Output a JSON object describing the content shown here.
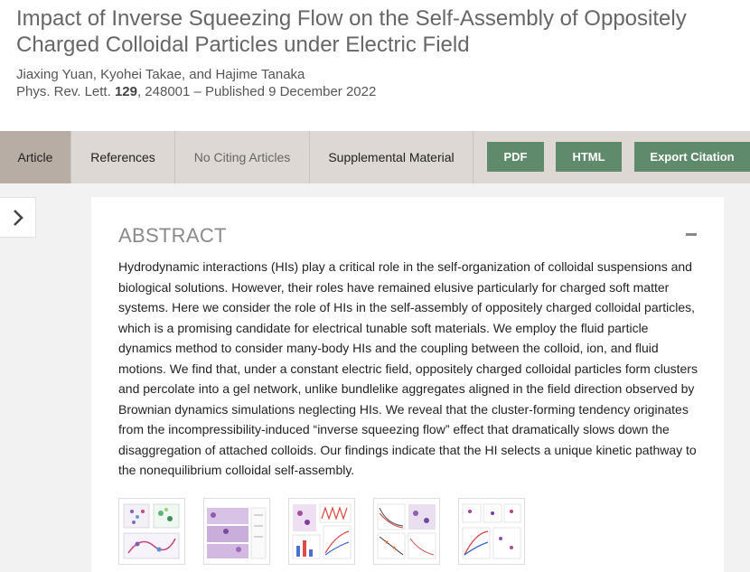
{
  "article": {
    "title": "Impact of Inverse Squeezing Flow on the Self-Assembly of Oppositely Charged Colloidal Particles under Electric Field",
    "authors": "Jiaxing Yuan, Kyohei Takae, and Hajime Tanaka",
    "journal": "Phys. Rev. Lett.",
    "volume": "129",
    "pages_published": ", 248001 – Published 9 December 2022"
  },
  "tabs": {
    "article": "Article",
    "references": "References",
    "citing": "No Citing Articles",
    "supplemental": "Supplemental Material"
  },
  "buttons": {
    "pdf": "PDF",
    "html": "HTML",
    "export": "Export Citation"
  },
  "abstract": {
    "heading": "ABSTRACT",
    "text": "Hydrodynamic interactions (HIs) play a critical role in the self-organization of colloidal suspensions and biological solutions. However, their roles have remained elusive particularly for charged soft matter systems. Here we consider the role of HIs in the self-assembly of oppositely charged colloidal particles, which is a promising candidate for electrical tunable soft materials. We employ the fluid particle dynamics method to consider many-body HIs and the coupling between the colloid, ion, and fluid motions. We find that, under a constant electric field, oppositely charged colloidal particles form clusters and percolate into a gel network, unlike bundlelike aggregates aligned in the field direction observed by Brownian dynamics simulations neglecting HIs. We reveal that the cluster-forming tendency originates from the incompressibility-induced “inverse squeezing flow” effect that dramatically slows down the disaggregation of attached colloids. Our findings indicate that the HI selects a unique kinetic pathway to the nonequilibrium colloidal self-assembly."
  },
  "figures": [
    {
      "name": "figure-1-thumbnail"
    },
    {
      "name": "figure-2-thumbnail"
    },
    {
      "name": "figure-3-thumbnail"
    },
    {
      "name": "figure-4-thumbnail"
    },
    {
      "name": "figure-5-thumbnail"
    }
  ],
  "colors": {
    "accent_green": "#5f8a6b",
    "tab_bar": "#ddd8d3",
    "tab_active": "#b7ada5"
  },
  "icons": {
    "sidebar_toggle": "chevron-right-icon",
    "collapse": "minus-icon"
  }
}
